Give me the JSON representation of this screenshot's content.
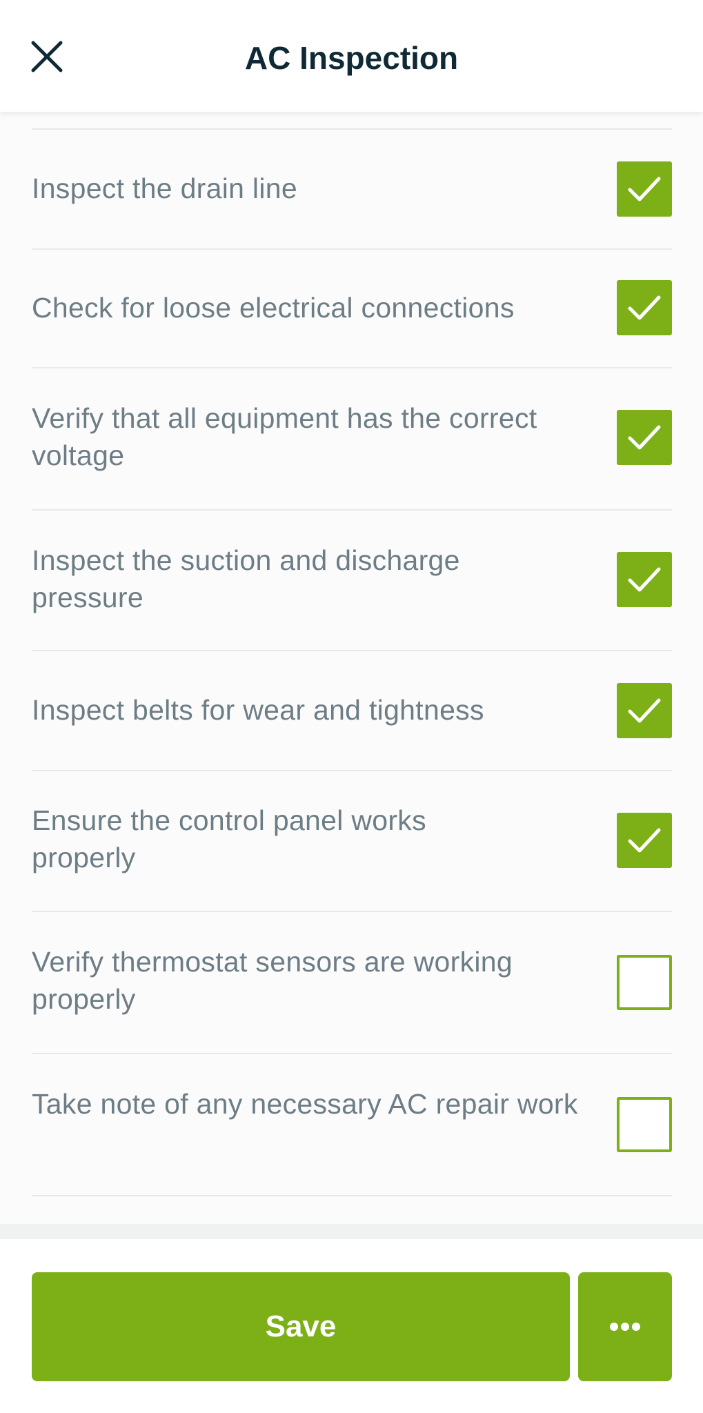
{
  "header": {
    "title": "AC Inspection",
    "close_icon": "close-icon"
  },
  "checklist": {
    "items": [
      {
        "label": "Inspect the drain line",
        "checked": true
      },
      {
        "label": "Check for loose electrical connections",
        "checked": true
      },
      {
        "label": "Verify that all equipment has the correct voltage",
        "checked": true
      },
      {
        "label": "Inspect the suction and discharge pressure",
        "checked": true
      },
      {
        "label": "Inspect belts for wear and tightness",
        "checked": true
      },
      {
        "label": "Ensure the control panel works properly",
        "checked": true
      },
      {
        "label": "Verify thermostat sensors are working properly",
        "checked": false
      },
      {
        "label": "Take note of any necessary AC repair work",
        "checked": false
      }
    ]
  },
  "footer": {
    "save_label": "Save",
    "more_icon": "more-horizontal-icon"
  },
  "colors": {
    "accent": "#7cb016",
    "title": "#0f2a34",
    "label": "#6d7d85",
    "divider": "#e6e9ea"
  }
}
